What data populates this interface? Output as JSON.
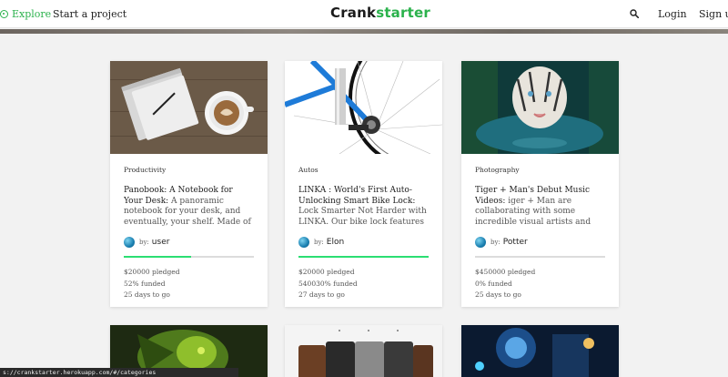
{
  "header": {
    "explore_label": "Explore",
    "start_label": "Start a project",
    "logo_part1": "Crank",
    "logo_part2": "starter",
    "login_label": "Login",
    "signup_label": "Sign up!"
  },
  "colors": {
    "brand_green": "#2bb24c",
    "progress_green": "#2bde73",
    "background": "#f2f2f2"
  },
  "cards": [
    {
      "category": "Productivity",
      "title": "Panobook: A Notebook for Your Desk:",
      "description": " A panoramic notebook for your desk, and eventually, your shelf. Made of q...",
      "by": "by:",
      "author": "user",
      "funded_fraction": 0.52,
      "pledged": "$20000 pledged",
      "funded": "52% funded",
      "days": "25 days to go"
    },
    {
      "category": "Autos",
      "title": "LINKA : World's First Auto-Unlocking Smart Bike Lock:",
      "description": " Lock Smarter Not Harder with LINKA. Our bike lock features Tamper Alerts,...",
      "by": "by:",
      "author": "Elon",
      "funded_fraction": 1.0,
      "pledged": "$20000 pledged",
      "funded": "540030% funded",
      "days": "27 days to go"
    },
    {
      "category": "Photography",
      "title": "Tiger + Man's Debut Music Videos:",
      "description": " iger + Man are collaborating with some incredible visual artists and directors to create thei...",
      "by": "by:",
      "author": "Potter",
      "funded_fraction": 0.0,
      "pledged": "$450000 pledged",
      "funded": "0% funded",
      "days": "25 days to go"
    }
  ],
  "status_url": "s://crankstarter.herokuapp.com/#/categories"
}
